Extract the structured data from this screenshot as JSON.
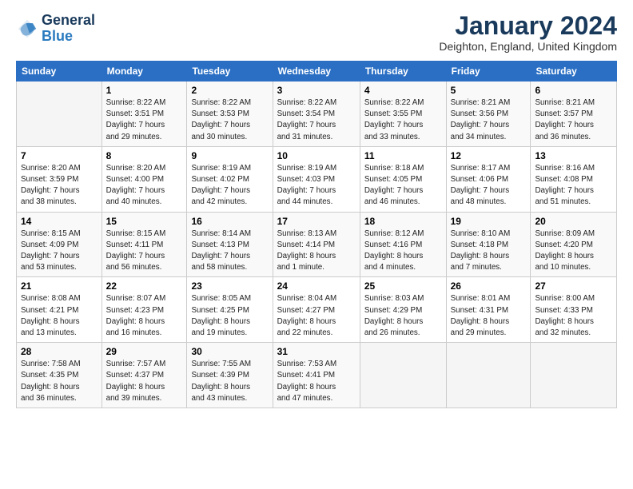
{
  "logo": {
    "line1": "General",
    "line2": "Blue"
  },
  "title": "January 2024",
  "location": "Deighton, England, United Kingdom",
  "days_header": [
    "Sunday",
    "Monday",
    "Tuesday",
    "Wednesday",
    "Thursday",
    "Friday",
    "Saturday"
  ],
  "weeks": [
    [
      {
        "num": "",
        "info": ""
      },
      {
        "num": "1",
        "info": "Sunrise: 8:22 AM\nSunset: 3:51 PM\nDaylight: 7 hours\nand 29 minutes."
      },
      {
        "num": "2",
        "info": "Sunrise: 8:22 AM\nSunset: 3:53 PM\nDaylight: 7 hours\nand 30 minutes."
      },
      {
        "num": "3",
        "info": "Sunrise: 8:22 AM\nSunset: 3:54 PM\nDaylight: 7 hours\nand 31 minutes."
      },
      {
        "num": "4",
        "info": "Sunrise: 8:22 AM\nSunset: 3:55 PM\nDaylight: 7 hours\nand 33 minutes."
      },
      {
        "num": "5",
        "info": "Sunrise: 8:21 AM\nSunset: 3:56 PM\nDaylight: 7 hours\nand 34 minutes."
      },
      {
        "num": "6",
        "info": "Sunrise: 8:21 AM\nSunset: 3:57 PM\nDaylight: 7 hours\nand 36 minutes."
      }
    ],
    [
      {
        "num": "7",
        "info": "Sunrise: 8:20 AM\nSunset: 3:59 PM\nDaylight: 7 hours\nand 38 minutes."
      },
      {
        "num": "8",
        "info": "Sunrise: 8:20 AM\nSunset: 4:00 PM\nDaylight: 7 hours\nand 40 minutes."
      },
      {
        "num": "9",
        "info": "Sunrise: 8:19 AM\nSunset: 4:02 PM\nDaylight: 7 hours\nand 42 minutes."
      },
      {
        "num": "10",
        "info": "Sunrise: 8:19 AM\nSunset: 4:03 PM\nDaylight: 7 hours\nand 44 minutes."
      },
      {
        "num": "11",
        "info": "Sunrise: 8:18 AM\nSunset: 4:05 PM\nDaylight: 7 hours\nand 46 minutes."
      },
      {
        "num": "12",
        "info": "Sunrise: 8:17 AM\nSunset: 4:06 PM\nDaylight: 7 hours\nand 48 minutes."
      },
      {
        "num": "13",
        "info": "Sunrise: 8:16 AM\nSunset: 4:08 PM\nDaylight: 7 hours\nand 51 minutes."
      }
    ],
    [
      {
        "num": "14",
        "info": "Sunrise: 8:15 AM\nSunset: 4:09 PM\nDaylight: 7 hours\nand 53 minutes."
      },
      {
        "num": "15",
        "info": "Sunrise: 8:15 AM\nSunset: 4:11 PM\nDaylight: 7 hours\nand 56 minutes."
      },
      {
        "num": "16",
        "info": "Sunrise: 8:14 AM\nSunset: 4:13 PM\nDaylight: 7 hours\nand 58 minutes."
      },
      {
        "num": "17",
        "info": "Sunrise: 8:13 AM\nSunset: 4:14 PM\nDaylight: 8 hours\nand 1 minute."
      },
      {
        "num": "18",
        "info": "Sunrise: 8:12 AM\nSunset: 4:16 PM\nDaylight: 8 hours\nand 4 minutes."
      },
      {
        "num": "19",
        "info": "Sunrise: 8:10 AM\nSunset: 4:18 PM\nDaylight: 8 hours\nand 7 minutes."
      },
      {
        "num": "20",
        "info": "Sunrise: 8:09 AM\nSunset: 4:20 PM\nDaylight: 8 hours\nand 10 minutes."
      }
    ],
    [
      {
        "num": "21",
        "info": "Sunrise: 8:08 AM\nSunset: 4:21 PM\nDaylight: 8 hours\nand 13 minutes."
      },
      {
        "num": "22",
        "info": "Sunrise: 8:07 AM\nSunset: 4:23 PM\nDaylight: 8 hours\nand 16 minutes."
      },
      {
        "num": "23",
        "info": "Sunrise: 8:05 AM\nSunset: 4:25 PM\nDaylight: 8 hours\nand 19 minutes."
      },
      {
        "num": "24",
        "info": "Sunrise: 8:04 AM\nSunset: 4:27 PM\nDaylight: 8 hours\nand 22 minutes."
      },
      {
        "num": "25",
        "info": "Sunrise: 8:03 AM\nSunset: 4:29 PM\nDaylight: 8 hours\nand 26 minutes."
      },
      {
        "num": "26",
        "info": "Sunrise: 8:01 AM\nSunset: 4:31 PM\nDaylight: 8 hours\nand 29 minutes."
      },
      {
        "num": "27",
        "info": "Sunrise: 8:00 AM\nSunset: 4:33 PM\nDaylight: 8 hours\nand 32 minutes."
      }
    ],
    [
      {
        "num": "28",
        "info": "Sunrise: 7:58 AM\nSunset: 4:35 PM\nDaylight: 8 hours\nand 36 minutes."
      },
      {
        "num": "29",
        "info": "Sunrise: 7:57 AM\nSunset: 4:37 PM\nDaylight: 8 hours\nand 39 minutes."
      },
      {
        "num": "30",
        "info": "Sunrise: 7:55 AM\nSunset: 4:39 PM\nDaylight: 8 hours\nand 43 minutes."
      },
      {
        "num": "31",
        "info": "Sunrise: 7:53 AM\nSunset: 4:41 PM\nDaylight: 8 hours\nand 47 minutes."
      },
      {
        "num": "",
        "info": ""
      },
      {
        "num": "",
        "info": ""
      },
      {
        "num": "",
        "info": ""
      }
    ]
  ]
}
